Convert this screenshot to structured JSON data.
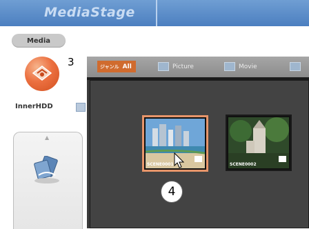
{
  "header": {
    "brand": "MediaStage"
  },
  "sidebar": {
    "media_label": "Media",
    "device_label": "InnerHDD"
  },
  "callouts": {
    "c3": "3",
    "c4": "4"
  },
  "tabs": {
    "all_prefix": "ジャンル",
    "all": "All",
    "picture": "Picture",
    "movie": "Movie"
  },
  "thumbnails": [
    {
      "caption": "SCENE0001",
      "selected": true
    },
    {
      "caption": "SCENE0002",
      "selected": false
    }
  ],
  "colors": {
    "header": "#5a8ccb",
    "accent_orange": "#d06b2e",
    "selection_border": "#e8956a",
    "panel_bg": "#434343"
  },
  "icons": [
    "inner-hdd-icon",
    "device-icon",
    "picture-tab-icon",
    "movie-tab-icon",
    "pointer-cursor-icon"
  ]
}
